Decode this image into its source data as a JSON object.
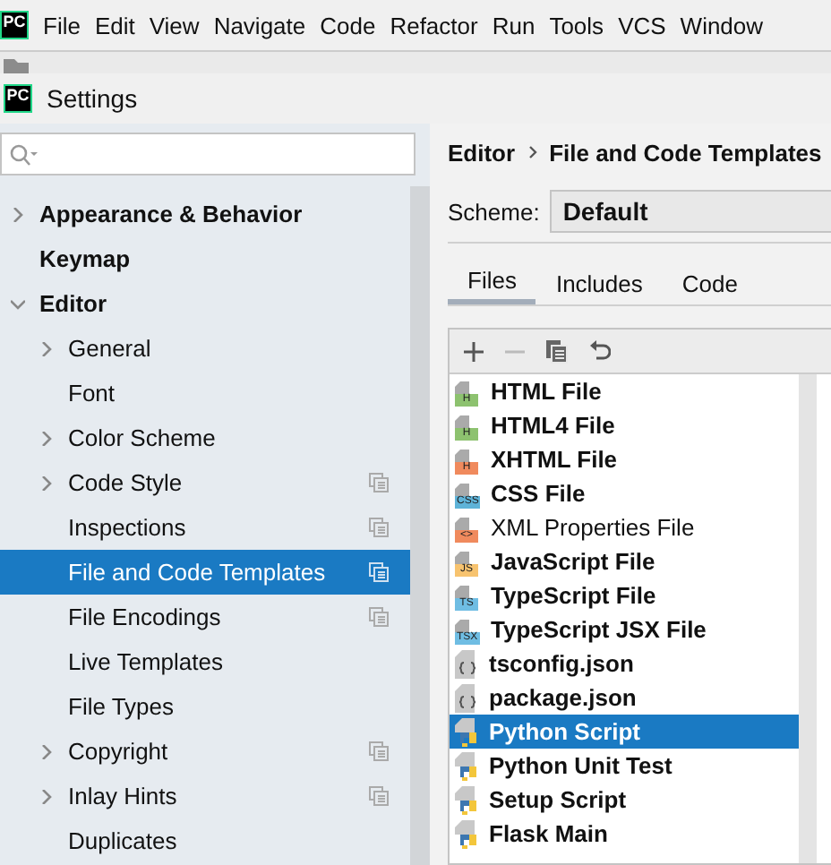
{
  "menu_bar": {
    "logo": "PC",
    "items": [
      "File",
      "Edit",
      "View",
      "Navigate",
      "Code",
      "Refactor",
      "Run",
      "Tools",
      "VCS",
      "Window"
    ]
  },
  "window": {
    "logo": "PC",
    "title": "Settings"
  },
  "sidebar": {
    "items": [
      {
        "label": "Appearance & Behavior",
        "bold": true,
        "expanded": false,
        "per_project": false,
        "selected": false
      },
      {
        "label": "Keymap",
        "bold": true,
        "per_project": false,
        "selected": false
      },
      {
        "label": "Editor",
        "bold": true,
        "expanded": true,
        "per_project": false,
        "selected": false,
        "children": [
          {
            "label": "General",
            "expanded": false,
            "per_project": false,
            "selected": false
          },
          {
            "label": "Font",
            "per_project": false,
            "selected": false
          },
          {
            "label": "Color Scheme",
            "expanded": false,
            "per_project": false,
            "selected": false
          },
          {
            "label": "Code Style",
            "expanded": false,
            "per_project": true,
            "selected": false
          },
          {
            "label": "Inspections",
            "per_project": true,
            "selected": false
          },
          {
            "label": "File and Code Templates",
            "per_project": true,
            "selected": true
          },
          {
            "label": "File Encodings",
            "per_project": true,
            "selected": false
          },
          {
            "label": "Live Templates",
            "per_project": false,
            "selected": false
          },
          {
            "label": "File Types",
            "per_project": false,
            "selected": false
          },
          {
            "label": "Copyright",
            "expanded": false,
            "per_project": true,
            "selected": false
          },
          {
            "label": "Inlay Hints",
            "expanded": false,
            "per_project": true,
            "selected": false
          },
          {
            "label": "Duplicates",
            "per_project": false,
            "selected": false
          }
        ]
      }
    ]
  },
  "breadcrumb": [
    "Editor",
    "File and Code Templates"
  ],
  "scheme": {
    "label": "Scheme:",
    "value": "Default"
  },
  "tabs": [
    {
      "label": "Files",
      "selected": true
    },
    {
      "label": "Includes",
      "selected": false
    },
    {
      "label": "Code",
      "selected": false
    }
  ],
  "templates": [
    {
      "label": "HTML File",
      "kind": "file",
      "badge": "H",
      "color": "#8dc26f",
      "bold": true,
      "selected": false
    },
    {
      "label": "HTML4 File",
      "kind": "file",
      "badge": "H",
      "color": "#8dc26f",
      "bold": true,
      "selected": false
    },
    {
      "label": "XHTML File",
      "kind": "file",
      "badge": "H",
      "color": "#f08a5d",
      "bold": true,
      "selected": false
    },
    {
      "label": "CSS File",
      "kind": "file",
      "badge": "CSS",
      "color": "#5eb3d8",
      "bold": true,
      "selected": false
    },
    {
      "label": "XML Properties File",
      "kind": "file",
      "badge": "<>",
      "color": "#f08a5d",
      "bold": false,
      "selected": false
    },
    {
      "label": "JavaScript File",
      "kind": "file",
      "badge": "JS",
      "color": "#f7c36f",
      "bold": true,
      "selected": false
    },
    {
      "label": "TypeScript File",
      "kind": "file",
      "badge": "TS",
      "color": "#6fbde3",
      "bold": true,
      "selected": false
    },
    {
      "label": "TypeScript JSX File",
      "kind": "file",
      "badge": "TSX",
      "color": "#6fbde3",
      "bold": true,
      "selected": false
    },
    {
      "label": "tsconfig.json",
      "kind": "json",
      "bold": true,
      "selected": false
    },
    {
      "label": "package.json",
      "kind": "json",
      "bold": true,
      "selected": false
    },
    {
      "label": "Python Script",
      "kind": "python",
      "bold": true,
      "selected": true
    },
    {
      "label": "Python Unit Test",
      "kind": "python",
      "bold": true,
      "selected": false
    },
    {
      "label": "Setup Script",
      "kind": "python",
      "bold": true,
      "selected": false
    },
    {
      "label": "Flask Main",
      "kind": "python",
      "bold": true,
      "selected": false
    }
  ]
}
